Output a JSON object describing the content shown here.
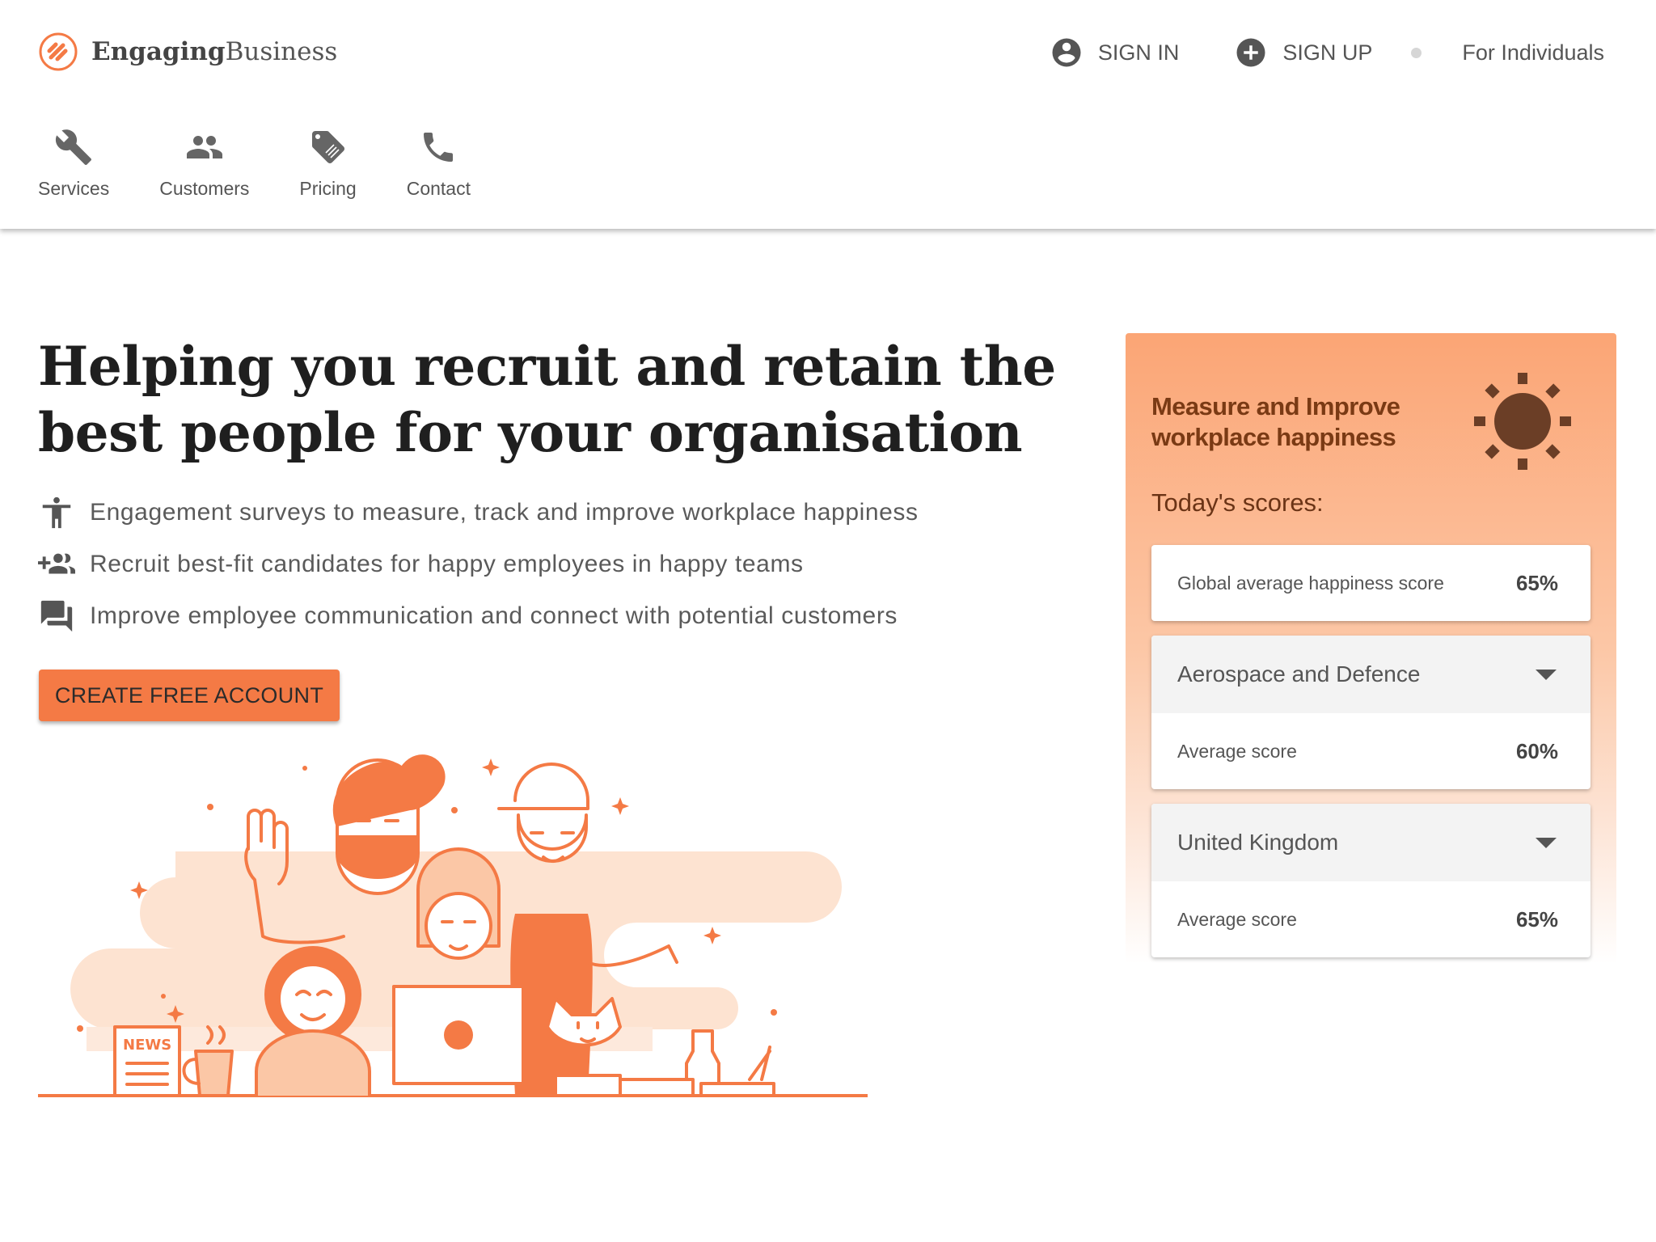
{
  "brand": {
    "name_bold": "Engaging",
    "name_regular": "Business",
    "accent": "#f47a45"
  },
  "top_actions": {
    "sign_in": "SIGN IN",
    "sign_up": "SIGN UP",
    "for_individuals": "For Individuals"
  },
  "nav": [
    {
      "label": "Services",
      "icon": "wrench-icon"
    },
    {
      "label": "Customers",
      "icon": "people-icon"
    },
    {
      "label": "Pricing",
      "icon": "price-tag-icon"
    },
    {
      "label": "Contact",
      "icon": "phone-icon"
    }
  ],
  "hero": {
    "title": "Helping you recruit and retain the best people for your organisation",
    "features": [
      {
        "icon": "accessibility-icon",
        "text": "Engagement surveys to measure, track and improve workplace happiness"
      },
      {
        "icon": "group-add-icon",
        "text": "Recruit best-fit candidates for happy employees in happy teams"
      },
      {
        "icon": "forum-icon",
        "text": "Improve employee communication and connect with potential customers"
      }
    ],
    "cta": "CREATE FREE ACCOUNT",
    "illustration_text": "NEWS"
  },
  "widget": {
    "title": "Measure and Improve workplace happiness",
    "scores_label": "Today's scores:",
    "global": {
      "label": "Global average happiness score",
      "value": "65%"
    },
    "industry": {
      "selected": "Aerospace and Defence",
      "label": "Average score",
      "value": "60%"
    },
    "country": {
      "selected": "United Kingdom",
      "label": "Average score",
      "value": "65%"
    }
  }
}
